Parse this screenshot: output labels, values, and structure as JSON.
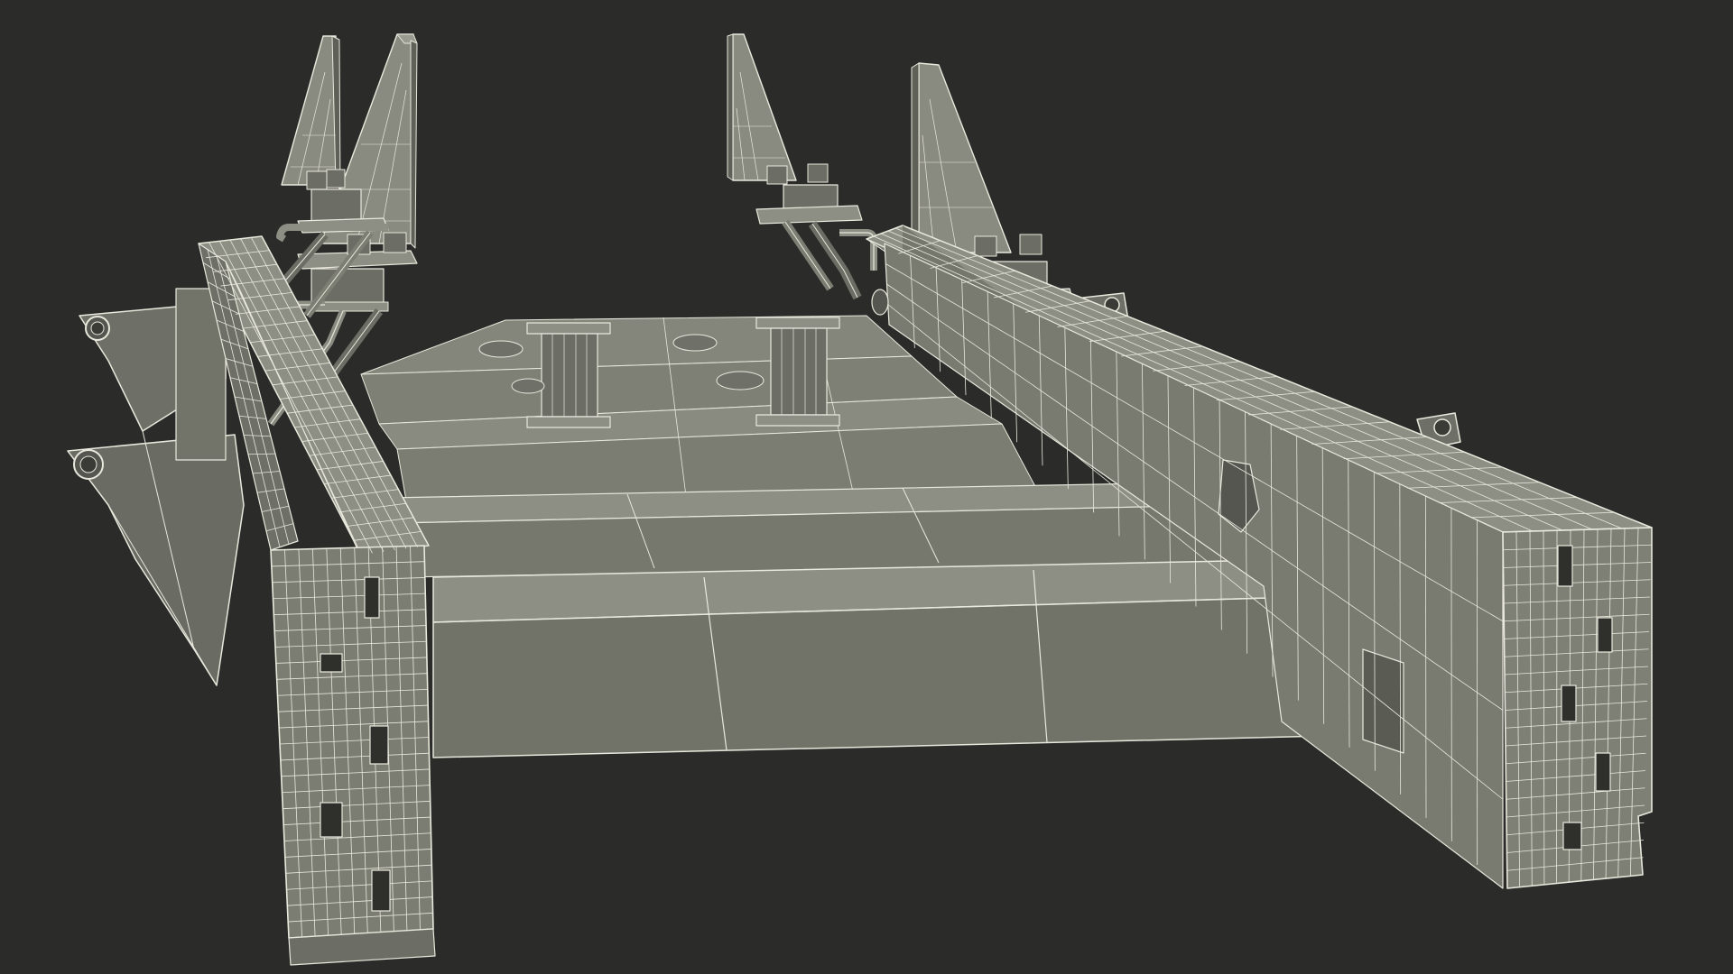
{
  "scene": {
    "background_color": "#2b2b29",
    "surface_color": "#7d7e73",
    "surface_dark_color": "#5f6058",
    "surface_light_color": "#8e8f84",
    "wire_color": "#e8e8dd"
  }
}
